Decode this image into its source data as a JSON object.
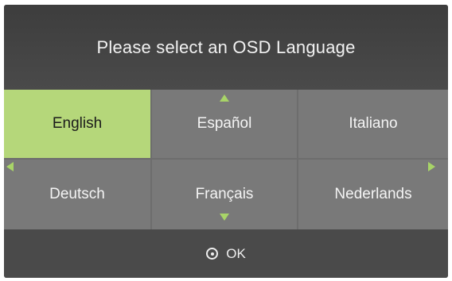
{
  "header": {
    "title": "Please select an OSD Language"
  },
  "languages": [
    {
      "label": "English",
      "selected": true
    },
    {
      "label": "Español",
      "selected": false
    },
    {
      "label": "Italiano",
      "selected": false
    },
    {
      "label": "Deutsch",
      "selected": false
    },
    {
      "label": "Français",
      "selected": false
    },
    {
      "label": "Nederlands",
      "selected": false
    }
  ],
  "footer": {
    "ok_label": "OK",
    "ok_icon": "radio-dot-icon"
  },
  "colors": {
    "background": "#4a4a4a",
    "cell": "#797979",
    "selected": "#b5d77a",
    "arrow": "#a8d468"
  }
}
